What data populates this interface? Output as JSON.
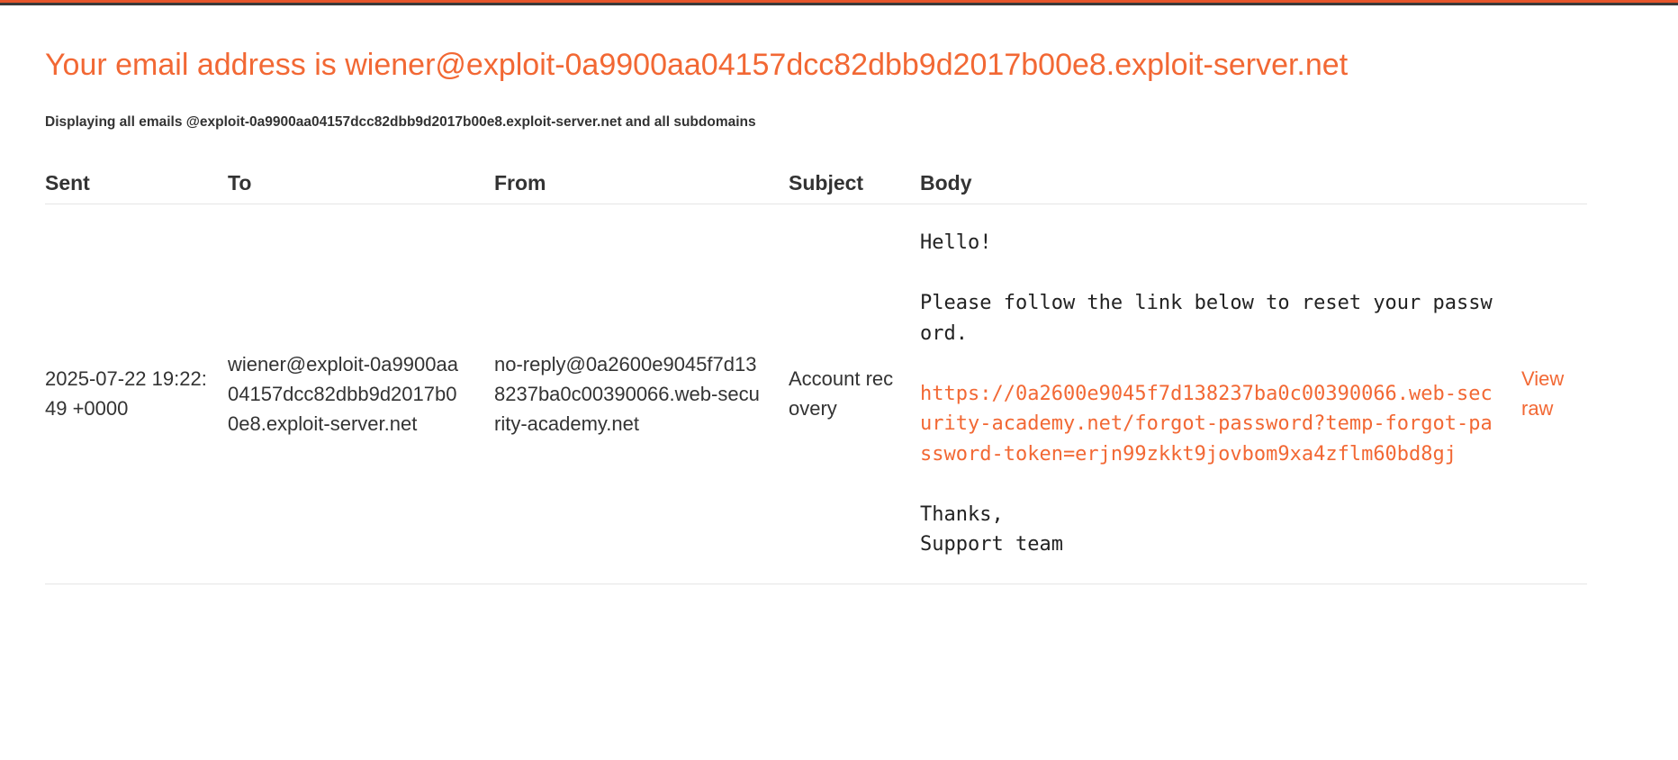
{
  "header": {
    "title": "Your email address is wiener@exploit-0a9900aa04157dcc82dbb9d2017b00e8.exploit-server.net",
    "subtitle": "Displaying all emails @exploit-0a9900aa04157dcc82dbb9d2017b00e8.exploit-server.net and all subdomains"
  },
  "colors": {
    "accent": "#f26834",
    "text": "#333333"
  },
  "table": {
    "columns": [
      "Sent",
      "To",
      "From",
      "Subject",
      "Body"
    ],
    "rows": [
      {
        "sent": "2025-07-22 19:22:49 +0000",
        "to": "wiener@exploit-0a9900aa04157dcc82dbb9d2017b00e8.exploit-server.net",
        "from": "no-reply@0a2600e9045f7d138237ba0c00390066.web-security-academy.net",
        "subject": "Account recovery",
        "body_intro": "Hello!\n\nPlease follow the link below to reset your password.\n\n",
        "body_link": "https://0a2600e9045f7d138237ba0c00390066.web-security-academy.net/forgot-password?temp-forgot-password-token=erjn99zkkt9jovbom9xa4zflm60bd8gj",
        "body_outro": "\n\nThanks,\nSupport team",
        "action_label": "View raw"
      }
    ]
  }
}
